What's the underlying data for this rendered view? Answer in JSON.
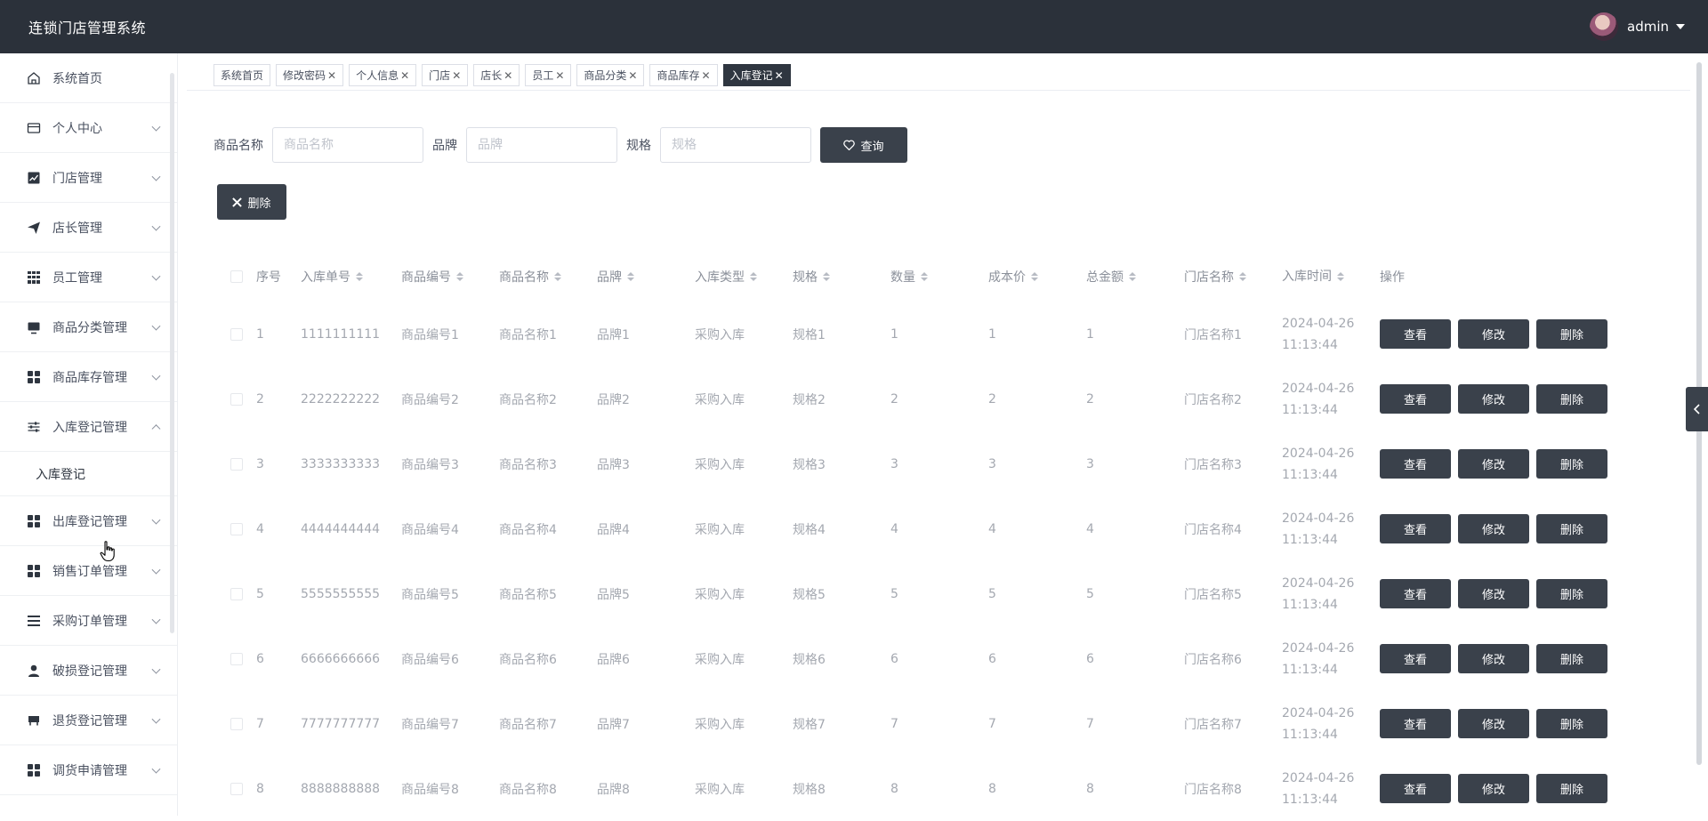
{
  "header": {
    "title": "连锁门店管理系统",
    "user": "admin"
  },
  "sidebar": {
    "items": [
      {
        "label": "系统首页",
        "icon": "home-icon",
        "chevron": false
      },
      {
        "label": "个人中心",
        "icon": "card-icon",
        "chevron": true
      },
      {
        "label": "门店管理",
        "icon": "chart-icon",
        "chevron": true
      },
      {
        "label": "店长管理",
        "icon": "send-icon",
        "chevron": true
      },
      {
        "label": "员工管理",
        "icon": "grid-icon",
        "chevron": true
      },
      {
        "label": "商品分类管理",
        "icon": "monitor-icon",
        "chevron": true
      },
      {
        "label": "商品库存管理",
        "icon": "apps-icon",
        "chevron": true
      },
      {
        "label": "入库登记管理",
        "icon": "sliders-icon",
        "chevron": true,
        "expanded": true
      },
      {
        "label": "出库登记管理",
        "icon": "apps-icon",
        "chevron": true
      },
      {
        "label": "销售订单管理",
        "icon": "apps-icon",
        "chevron": true
      },
      {
        "label": "采购订单管理",
        "icon": "list-icon",
        "chevron": true
      },
      {
        "label": "破损登记管理",
        "icon": "user-icon",
        "chevron": true
      },
      {
        "label": "退货登记管理",
        "icon": "cup-icon",
        "chevron": true
      },
      {
        "label": "调货申请管理",
        "icon": "apps-icon",
        "chevron": true
      }
    ],
    "submenu": {
      "label": "入库登记"
    }
  },
  "tabs": [
    {
      "label": "系统首页",
      "closable": false
    },
    {
      "label": "修改密码",
      "closable": true
    },
    {
      "label": "个人信息",
      "closable": true
    },
    {
      "label": "门店",
      "closable": true
    },
    {
      "label": "店长",
      "closable": true
    },
    {
      "label": "员工",
      "closable": true
    },
    {
      "label": "商品分类",
      "closable": true
    },
    {
      "label": "商品库存",
      "closable": true
    },
    {
      "label": "入库登记",
      "closable": true,
      "active": true
    }
  ],
  "search": {
    "goods_name_label": "商品名称",
    "goods_name_placeholder": "商品名称",
    "brand_label": "品牌",
    "brand_placeholder": "品牌",
    "spec_label": "规格",
    "spec_placeholder": "规格",
    "query_button": "查询",
    "delete_button": "删除"
  },
  "table": {
    "headers": [
      "序号",
      "入库单号",
      "商品编号",
      "商品名称",
      "品牌",
      "入库类型",
      "规格",
      "数量",
      "成本价",
      "总金额",
      "门店名称",
      "入库时间",
      "操作"
    ],
    "sortable": [
      false,
      true,
      true,
      true,
      true,
      true,
      true,
      true,
      true,
      true,
      true,
      true,
      false
    ],
    "rows": [
      {
        "seq": "1",
        "no": "1111111111",
        "goods_no": "商品编号1",
        "goods_name": "商品名称1",
        "brand": "品牌1",
        "type": "采购入库",
        "spec": "规格1",
        "qty": "1",
        "cost": "1",
        "total": "1",
        "store": "门店名称1",
        "date": "2024-04-26",
        "time": "11:13:44"
      },
      {
        "seq": "2",
        "no": "2222222222",
        "goods_no": "商品编号2",
        "goods_name": "商品名称2",
        "brand": "品牌2",
        "type": "采购入库",
        "spec": "规格2",
        "qty": "2",
        "cost": "2",
        "total": "2",
        "store": "门店名称2",
        "date": "2024-04-26",
        "time": "11:13:44"
      },
      {
        "seq": "3",
        "no": "3333333333",
        "goods_no": "商品编号3",
        "goods_name": "商品名称3",
        "brand": "品牌3",
        "type": "采购入库",
        "spec": "规格3",
        "qty": "3",
        "cost": "3",
        "total": "3",
        "store": "门店名称3",
        "date": "2024-04-26",
        "time": "11:13:44"
      },
      {
        "seq": "4",
        "no": "4444444444",
        "goods_no": "商品编号4",
        "goods_name": "商品名称4",
        "brand": "品牌4",
        "type": "采购入库",
        "spec": "规格4",
        "qty": "4",
        "cost": "4",
        "total": "4",
        "store": "门店名称4",
        "date": "2024-04-26",
        "time": "11:13:44"
      },
      {
        "seq": "5",
        "no": "5555555555",
        "goods_no": "商品编号5",
        "goods_name": "商品名称5",
        "brand": "品牌5",
        "type": "采购入库",
        "spec": "规格5",
        "qty": "5",
        "cost": "5",
        "total": "5",
        "store": "门店名称5",
        "date": "2024-04-26",
        "time": "11:13:44"
      },
      {
        "seq": "6",
        "no": "6666666666",
        "goods_no": "商品编号6",
        "goods_name": "商品名称6",
        "brand": "品牌6",
        "type": "采购入库",
        "spec": "规格6",
        "qty": "6",
        "cost": "6",
        "total": "6",
        "store": "门店名称6",
        "date": "2024-04-26",
        "time": "11:13:44"
      },
      {
        "seq": "7",
        "no": "7777777777",
        "goods_no": "商品编号7",
        "goods_name": "商品名称7",
        "brand": "品牌7",
        "type": "采购入库",
        "spec": "规格7",
        "qty": "7",
        "cost": "7",
        "total": "7",
        "store": "门店名称7",
        "date": "2024-04-26",
        "time": "11:13:44"
      },
      {
        "seq": "8",
        "no": "8888888888",
        "goods_no": "商品编号8",
        "goods_name": "商品名称8",
        "brand": "品牌8",
        "type": "采购入库",
        "spec": "规格8",
        "qty": "8",
        "cost": "8",
        "total": "8",
        "store": "门店名称8",
        "date": "2024-04-26",
        "time": "11:13:44"
      }
    ],
    "actions": {
      "view": "查看",
      "edit": "修改",
      "delete": "删除"
    }
  },
  "colors": {
    "header_bg": "#2b313a",
    "button_dark": "#3a414b",
    "active_tab": "#2f3640"
  }
}
